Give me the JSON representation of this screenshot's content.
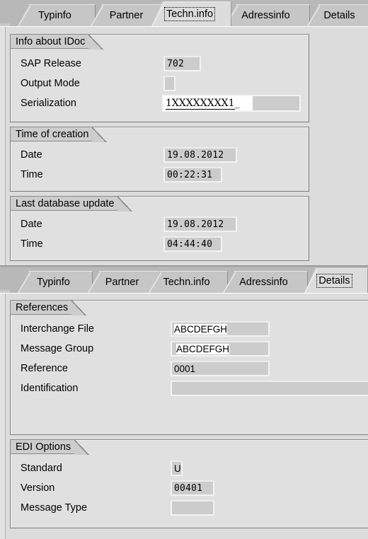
{
  "top_screen": {
    "tabs": [
      {
        "label": "Typinfo",
        "active": false
      },
      {
        "label": "Partner",
        "active": false
      },
      {
        "label": "Techn.info",
        "active": true
      },
      {
        "label": "Adressinfo",
        "active": false
      },
      {
        "label": "Details",
        "active": false
      }
    ],
    "groups": [
      {
        "title": "Info about IDoc",
        "rows": [
          {
            "label": "SAP Release",
            "value": "702",
            "style": "mono"
          },
          {
            "label": "Output Mode",
            "value": "",
            "style": "plain"
          },
          {
            "label": "Serialization",
            "value": "1XXXXXXXX1",
            "style": "serial"
          }
        ]
      },
      {
        "title": "Time of creation",
        "rows": [
          {
            "label": "Date",
            "value": "19.08.2012",
            "style": "mono"
          },
          {
            "label": "Time",
            "value": "00:22:31",
            "style": "mono"
          }
        ]
      },
      {
        "title": "Last database update",
        "rows": [
          {
            "label": "Date",
            "value": "19.08.2012",
            "style": "mono"
          },
          {
            "label": "Time",
            "value": "04:44:40",
            "style": "mono"
          }
        ]
      }
    ]
  },
  "bottom_screen": {
    "tabs": [
      {
        "label": "Typinfo",
        "active": false
      },
      {
        "label": "Partner",
        "active": false
      },
      {
        "label": "Techn.info",
        "active": false
      },
      {
        "label": "Adressinfo",
        "active": false
      },
      {
        "label": "Details",
        "active": true
      }
    ],
    "groups": [
      {
        "title": "References",
        "rows": [
          {
            "label": "Interchange File",
            "value": "ABCDEFGH",
            "style": "selected"
          },
          {
            "label": "Message Group",
            "value": "ABCDEFGH",
            "style": "selected"
          },
          {
            "label": "Reference",
            "value": "0001",
            "style": "plain"
          },
          {
            "label": "Identification",
            "value": "",
            "style": "wide"
          }
        ]
      },
      {
        "title": "EDI Options",
        "rows": [
          {
            "label": "Standard",
            "value": "U",
            "style": "plain"
          },
          {
            "label": "Version",
            "value": "00401",
            "style": "mono"
          },
          {
            "label": "Message Type",
            "value": "",
            "style": "plain"
          }
        ]
      }
    ]
  },
  "colors": {
    "window_background": "#e2e2e2",
    "panel_background": "#e0e0e0",
    "tabstrip_background": "#b8b8b8",
    "tab_inactive": "#c6c6c6",
    "tab_active": "#dcdcdc",
    "field_fill": "#cccccc",
    "field_border": "#f3f3f3",
    "group_border": "#7d7d7d",
    "text": "#000000"
  }
}
